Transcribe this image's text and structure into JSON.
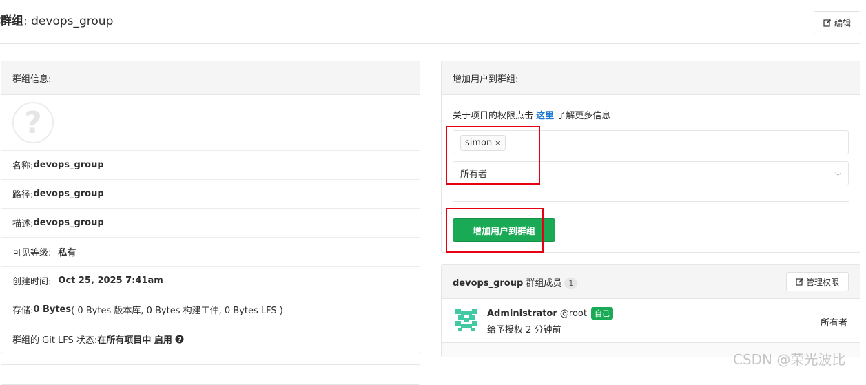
{
  "header": {
    "title_prefix": "群组",
    "title_name": ": devops_group",
    "edit_label": "编辑"
  },
  "group_info": {
    "heading": "群组信息:",
    "rows": [
      {
        "label": "名称: ",
        "value": "devops_group"
      },
      {
        "label": "路径: ",
        "value": "devops_group"
      },
      {
        "label": "描述: ",
        "value": "devops_group"
      },
      {
        "label": "可见等级:",
        "value": "私有"
      },
      {
        "label": "创建时间:",
        "value": "Oct 25, 2025 7:41am"
      }
    ],
    "storage_label": "存储: ",
    "storage_value": "0 Bytes",
    "storage_detail": " ( 0 Bytes 版本库, 0 Bytes 构建工件, 0 Bytes LFS )",
    "lfs_label": "群组的 Git LFS 状态: ",
    "lfs_value": "在所有项目中 启用"
  },
  "add_user": {
    "heading": "增加用户到群组:",
    "perm_prefix": "关于项目的权限点击 ",
    "perm_link": "这里",
    "perm_suffix": " 了解更多信息",
    "selected_user": "simon",
    "remove_token": "×",
    "role_value": "所有者",
    "submit_label": "增加用户到群组"
  },
  "members": {
    "group_name": "devops_group",
    "heading_suffix": " 群组成员",
    "count": "1",
    "manage_label": "管理权限",
    "list": [
      {
        "name": "Administrator",
        "username": " @root",
        "badge": "自己",
        "granted": "给予授权 2 分钟前",
        "role": "所有者"
      }
    ]
  },
  "watermark": "CSDN @荣光波比",
  "colors": {
    "accent_green": "#1aaa55",
    "link_blue": "#1f78d1",
    "highlight_red": "#e60012"
  }
}
